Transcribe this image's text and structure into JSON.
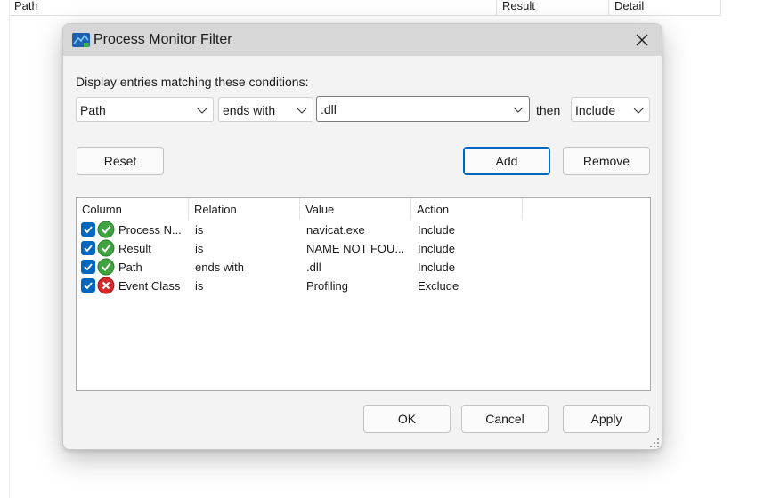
{
  "background": {
    "columns": {
      "path": "Path",
      "result": "Result",
      "detail": "Detail"
    }
  },
  "dialog": {
    "title": "Process Monitor Filter",
    "prompt": "Display entries matching these conditions:",
    "column_select": "Path",
    "relation_select": "ends with",
    "value_input": ".dll",
    "then_label": "then",
    "action_select": "Include",
    "reset_label": "Reset",
    "add_label": "Add",
    "remove_label": "Remove",
    "list_headers": {
      "column": "Column",
      "relation": "Relation",
      "value": "Value",
      "action": "Action"
    },
    "rows": [
      {
        "checked": true,
        "status": "include",
        "column": "Process N...",
        "relation": "is",
        "value": "navicat.exe",
        "action": "Include"
      },
      {
        "checked": true,
        "status": "include",
        "column": "Result",
        "relation": "is",
        "value": "NAME NOT FOU...",
        "action": "Include"
      },
      {
        "checked": true,
        "status": "include",
        "column": "Path",
        "relation": "ends with",
        "value": ".dll",
        "action": "Include"
      },
      {
        "checked": true,
        "status": "exclude",
        "column": "Event Class",
        "relation": "is",
        "value": "Profiling",
        "action": "Exclude"
      }
    ],
    "ok_label": "OK",
    "cancel_label": "Cancel",
    "apply_label": "Apply"
  },
  "colors": {
    "accent": "#0067c0",
    "include": "#3fa33f",
    "exclude": "#d42a2a"
  }
}
